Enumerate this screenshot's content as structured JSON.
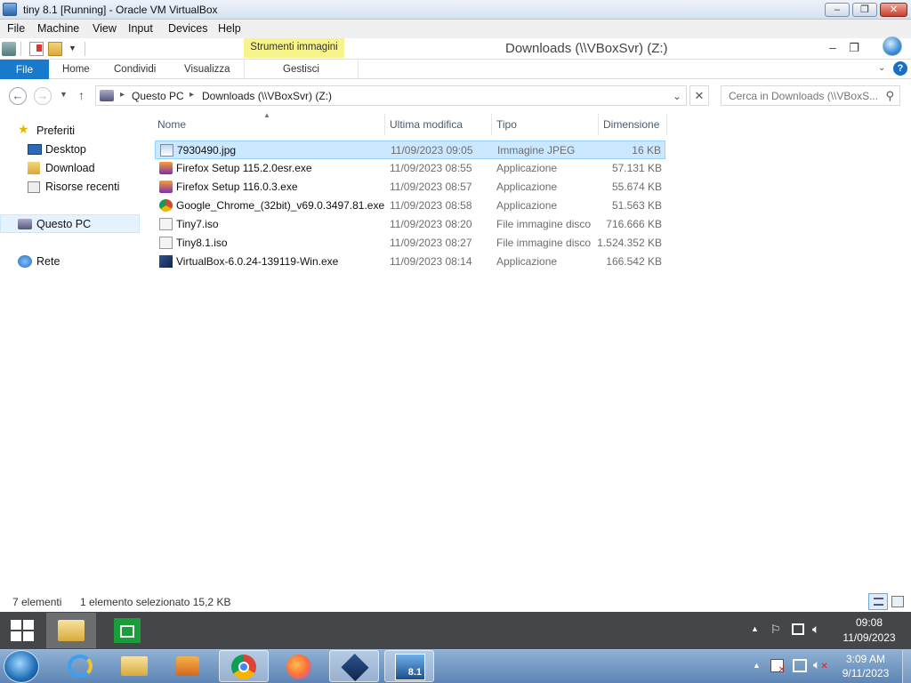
{
  "host": {
    "title": "tiny 8.1 [Running] - Oracle VM VirtualBox",
    "menu": [
      "File",
      "Machine",
      "View",
      "Input",
      "Devices",
      "Help"
    ],
    "clock_time": "3:09 AM",
    "clock_date": "9/11/2023"
  },
  "explorer": {
    "context_tab": "Strumenti immagini",
    "window_title": "Downloads (\\\\VBoxSvr) (Z:)",
    "ribbon_tabs": [
      "File",
      "Home",
      "Condividi",
      "Visualizza",
      "Gestisci"
    ],
    "breadcrumb": [
      "Questo PC",
      "Downloads (\\\\VBoxSvr) (Z:)"
    ],
    "search_placeholder": "Cerca in Downloads (\\\\VBoxS...",
    "nav": {
      "favorites": "Preferiti",
      "favorites_items": [
        "Desktop",
        "Download",
        "Risorse recenti"
      ],
      "this_pc": "Questo PC",
      "network": "Rete"
    },
    "columns": {
      "name": "Nome",
      "modified": "Ultima modifica",
      "type": "Tipo",
      "size": "Dimensione"
    },
    "files": [
      {
        "name": "7930490.jpg",
        "modified": "11/09/2023 09:05",
        "type": "Immagine JPEG",
        "size": "16 KB",
        "selected": true,
        "icon": "image-file-icon"
      },
      {
        "name": "Firefox Setup 115.2.0esr.exe",
        "modified": "11/09/2023 08:55",
        "type": "Applicazione",
        "size": "57.131 KB",
        "icon": "firefox-installer-icon"
      },
      {
        "name": "Firefox Setup 116.0.3.exe",
        "modified": "11/09/2023 08:57",
        "type": "Applicazione",
        "size": "55.674 KB",
        "icon": "firefox-installer-icon"
      },
      {
        "name": "Google_Chrome_(32bit)_v69.0.3497.81.exe",
        "modified": "11/09/2023 08:58",
        "type": "Applicazione",
        "size": "51.563 KB",
        "icon": "chrome-installer-icon"
      },
      {
        "name": "Tiny7.iso",
        "modified": "11/09/2023 08:20",
        "type": "File immagine disco",
        "size": "716.666 KB",
        "icon": "disc-image-icon"
      },
      {
        "name": "Tiny8.1.iso",
        "modified": "11/09/2023 08:27",
        "type": "File immagine disco",
        "size": "1.524.352 KB",
        "icon": "disc-image-icon"
      },
      {
        "name": "VirtualBox-6.0.24-139119-Win.exe",
        "modified": "11/09/2023 08:14",
        "type": "Applicazione",
        "size": "166.542 KB",
        "icon": "virtualbox-installer-icon"
      }
    ],
    "status_count": "7 elementi",
    "status_selection": "1 elemento selezionato  15,2 KB"
  },
  "guest_taskbar": {
    "clock_time": "09:08",
    "clock_date": "11/09/2023"
  },
  "colors": {
    "accent": "#1979ca",
    "selection": "#cce8ff",
    "guest_taskbar": "#45464a"
  }
}
